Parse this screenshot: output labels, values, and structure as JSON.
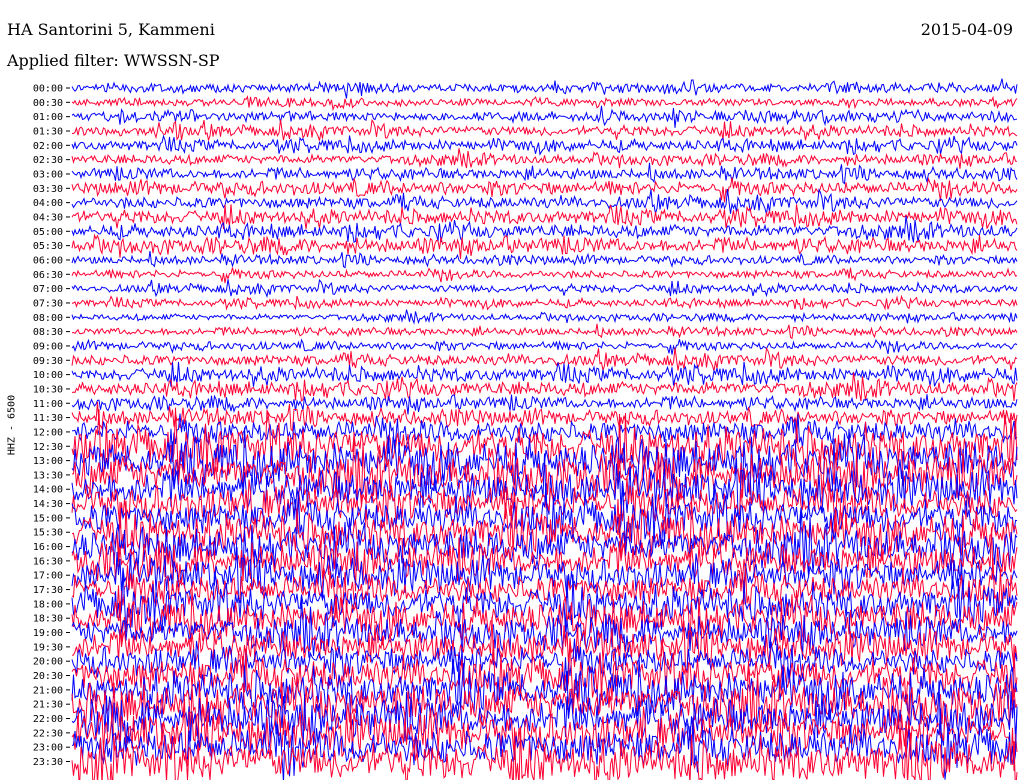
{
  "header": {
    "station": "HA Santorini 5, Kammeni",
    "filter": "Applied filter: WWSSN-SP",
    "date": "2015-04-09"
  },
  "chart_data": {
    "type": "line",
    "title": "HA Santorini 5, Kammeni",
    "subtitle": "Applied filter: WWSSN-SP",
    "date": "2015-04-09",
    "ylabel": "HHZ - 6500",
    "xlabel": "",
    "colors": [
      "#0000ff",
      "#ff0033"
    ],
    "grid": false,
    "y_tick_labels": [
      "00:00",
      "00:30",
      "01:00",
      "01:30",
      "02:00",
      "02:30",
      "03:00",
      "03:30",
      "04:00",
      "04:30",
      "05:00",
      "05:30",
      "06:00",
      "06:30",
      "07:00",
      "07:30",
      "08:00",
      "08:30",
      "09:00",
      "09:30",
      "10:00",
      "10:30",
      "11:00",
      "11:30",
      "12:00",
      "12:30",
      "13:00",
      "13:30",
      "14:00",
      "14:30",
      "15:00",
      "15:30",
      "16:00",
      "16:30",
      "17:00",
      "17:30",
      "18:00",
      "18:30",
      "19:00",
      "19:30",
      "20:00",
      "20:30",
      "21:00",
      "21:30",
      "22:00",
      "22:30",
      "23:00",
      "23:30"
    ],
    "trace_relative_amplitude": [
      0.9,
      0.7,
      0.9,
      1.0,
      1.0,
      0.9,
      1.0,
      1.3,
      1.2,
      1.3,
      1.2,
      1.3,
      0.8,
      0.8,
      0.8,
      0.7,
      0.6,
      0.7,
      0.8,
      1.1,
      1.3,
      1.3,
      1.1,
      1.4,
      2.2,
      3.4,
      3.4,
      3.4,
      3.2,
      3.2,
      3.2,
      3.2,
      3.1,
      3.0,
      2.9,
      2.9,
      3.0,
      3.0,
      2.7,
      2.7,
      2.7,
      3.3,
      3.3,
      3.4,
      3.4,
      3.5,
      3.6,
      3.6
    ]
  }
}
